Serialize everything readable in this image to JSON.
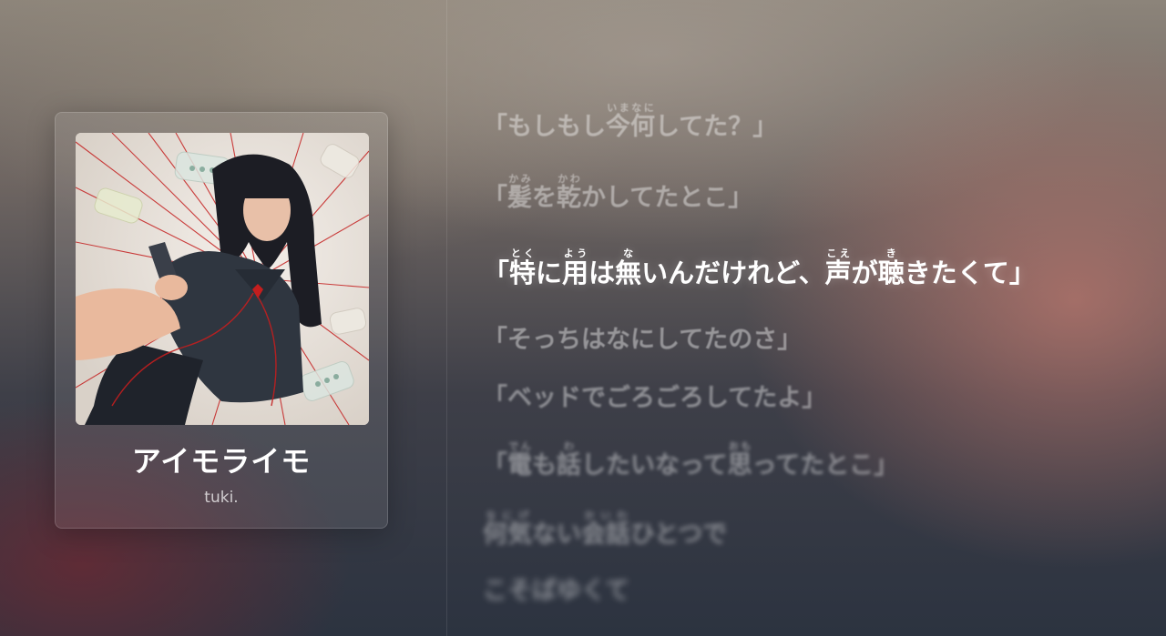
{
  "album": {
    "title": "アイモライモ",
    "artist": "tuki."
  },
  "colors": {
    "background_top": "#8c847a",
    "background_bottom": "#2c3340",
    "accent_red": "#c41e1e",
    "active_lyric": "#ffffff"
  },
  "lyrics": [
    {
      "segments": [
        {
          "t": "「もしもし"
        },
        {
          "t": "今",
          "r": "いま"
        },
        {
          "t": "何",
          "r": "なに"
        },
        {
          "t": "してた？」"
        }
      ],
      "state": "dim",
      "blur": 0.6
    },
    {
      "segments": [
        {
          "t": "「"
        },
        {
          "t": "髪",
          "r": "かみ"
        },
        {
          "t": "を"
        },
        {
          "t": "乾",
          "r": "かわ"
        },
        {
          "t": "かしてたとこ」"
        }
      ],
      "state": "dim",
      "blur": 0.4
    },
    {
      "segments": [
        {
          "t": "「"
        },
        {
          "t": "特",
          "r": "とく"
        },
        {
          "t": "に"
        },
        {
          "t": "用",
          "r": "よう"
        },
        {
          "t": "は"
        },
        {
          "t": "無",
          "r": "な"
        },
        {
          "t": "いんだけれど、"
        },
        {
          "t": "声",
          "r": "こえ"
        },
        {
          "t": "が"
        },
        {
          "t": "聴",
          "r": "き"
        },
        {
          "t": "きたくて」"
        }
      ],
      "state": "active",
      "blur": 0
    },
    {
      "segments": [
        {
          "t": "「そっちはなにしてたのさ」"
        }
      ],
      "state": "dim",
      "blur": 0.6
    },
    {
      "segments": [
        {
          "t": "「ベッドでごろごろしてたよ」"
        }
      ],
      "state": "dim",
      "blur": 1.0
    },
    {
      "segments": [
        {
          "t": "「"
        },
        {
          "t": "電",
          "r": "でん"
        },
        {
          "t": "も"
        },
        {
          "t": "話",
          "r": "わ"
        },
        {
          "t": "したいなって"
        },
        {
          "t": "思",
          "r": "おも"
        },
        {
          "t": "ってたとこ」"
        }
      ],
      "state": "dim",
      "blur": 1.8
    },
    {
      "segments": [
        {
          "t": "何気",
          "r": "なにげ"
        },
        {
          "t": "ない"
        },
        {
          "t": "会話",
          "r": "かいわ"
        },
        {
          "t": "ひとつで"
        }
      ],
      "state": "dim",
      "blur": 2.6
    },
    {
      "segments": [
        {
          "t": "こそばゆくて"
        }
      ],
      "state": "dim",
      "blur": 3.4
    }
  ]
}
